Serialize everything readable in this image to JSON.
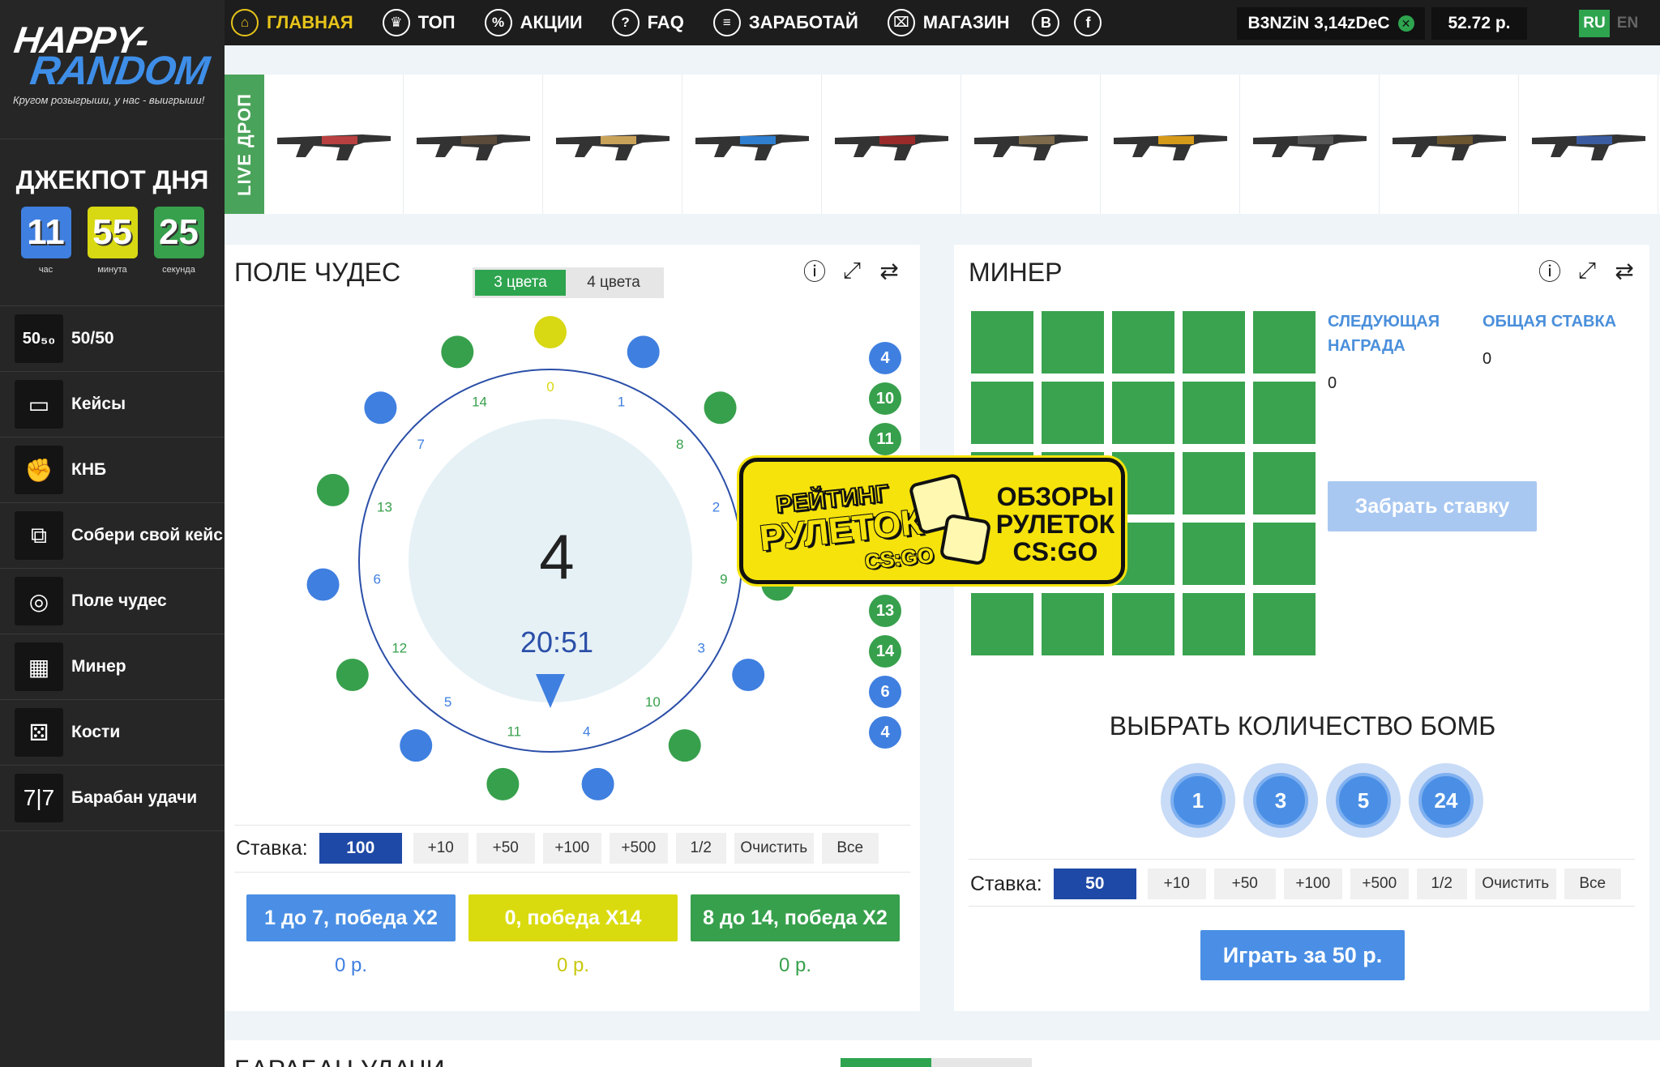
{
  "logo": {
    "line1": "HAPPY-",
    "line2": "RANDOM",
    "tagline": "Кругом розыгрыши, у нас - выигрыши!"
  },
  "jackpot": {
    "title": "ДЖЕКПОТ ДНЯ",
    "timer": [
      {
        "value": "11",
        "label": "час",
        "color": "#3f7fe0"
      },
      {
        "value": "55",
        "label": "минута",
        "color": "#d8d813"
      },
      {
        "value": "25",
        "label": "секунда",
        "color": "#37a04c"
      }
    ]
  },
  "sidebar": {
    "items": [
      {
        "label": "50/50",
        "icon": "5050-icon",
        "glyph": "50₅₀"
      },
      {
        "label": "Кейсы",
        "icon": "case-icon",
        "glyph": "▭"
      },
      {
        "label": "КНБ",
        "icon": "hand-icon",
        "glyph": "✊"
      },
      {
        "label": "Собери свой кейс",
        "icon": "build-case-icon",
        "glyph": "⧉"
      },
      {
        "label": "Поле чудес",
        "icon": "wheel-icon",
        "glyph": "◎"
      },
      {
        "label": "Минер",
        "icon": "grid-icon",
        "glyph": "▦"
      },
      {
        "label": "Кости",
        "icon": "dice-icon",
        "glyph": "⚄"
      },
      {
        "label": "Барабан удачи",
        "icon": "slot-icon",
        "glyph": "7|7"
      }
    ]
  },
  "topnav": {
    "items": [
      {
        "label": "ГЛАВНАЯ",
        "icon": "home-icon",
        "glyph": "⌂",
        "active": true
      },
      {
        "label": "ТОП",
        "icon": "crown-icon",
        "glyph": "♛"
      },
      {
        "label": "АКЦИИ",
        "icon": "percent-icon",
        "glyph": "%"
      },
      {
        "label": "FAQ",
        "icon": "faq-icon",
        "glyph": "?"
      },
      {
        "label": "ЗАРАБОТАЙ",
        "icon": "earn-icon",
        "glyph": "≡"
      },
      {
        "label": "МАГАЗИН",
        "icon": "cart-icon",
        "glyph": "⌧"
      }
    ],
    "social": [
      {
        "label": "B",
        "icon": "vk-icon"
      },
      {
        "label": "f",
        "icon": "facebook-icon"
      }
    ],
    "user": "B3NZiN 3,14zDeC",
    "balance": "52.72 р.",
    "lang_ru": "RU",
    "lang_en": "EN"
  },
  "livedrop": {
    "label": "LIVE ДРОП",
    "items": [
      {
        "name": "m4a1s-icon",
        "color": "#b94040"
      },
      {
        "name": "scar-icon",
        "color": "#5a4a3a"
      },
      {
        "name": "usp-icon",
        "color": "#c9a25a"
      },
      {
        "name": "mp7-icon",
        "color": "#2f7fd0"
      },
      {
        "name": "usp2-icon",
        "color": "#9b2a2a"
      },
      {
        "name": "mp9-icon",
        "color": "#7d6a4c"
      },
      {
        "name": "tec9-icon",
        "color": "#d69a1a"
      },
      {
        "name": "fiveseven-icon",
        "color": "#555"
      },
      {
        "name": "glock-icon",
        "color": "#6a5530"
      },
      {
        "name": "awp-icon",
        "color": "#3a5ba0"
      }
    ]
  },
  "wheel": {
    "title": "ПОЛЕ ЧУДЕС",
    "tab_on": "3 цвета",
    "tab_off": "4 цвета",
    "current": "4",
    "time": "20:51",
    "numbers": [
      "0",
      "1",
      "8",
      "2",
      "9",
      "3",
      "10",
      "4",
      "11",
      "5",
      "12",
      "6",
      "13",
      "7",
      "14"
    ],
    "history": [
      {
        "v": "4",
        "c": "#3f7fe0"
      },
      {
        "v": "10",
        "c": "#37a04c"
      },
      {
        "v": "11",
        "c": "#37a04c"
      },
      {
        "v": "13",
        "c": "#37a04c"
      },
      {
        "v": "14",
        "c": "#37a04c"
      },
      {
        "v": "6",
        "c": "#3f7fe0"
      },
      {
        "v": "4",
        "c": "#3f7fe0"
      }
    ],
    "bet": {
      "label": "Ставка:",
      "value": "100",
      "buttons": [
        "+10",
        "+50",
        "+100",
        "+500",
        "1/2",
        "Очистить",
        "Все"
      ]
    },
    "options": [
      {
        "label": "1 до 7, победа X2",
        "sum": "0 р.",
        "color": "#4a8fe5",
        "text_color": "#3f7fe0"
      },
      {
        "label": "0, победа X14",
        "sum": "0 р.",
        "color": "#dadb0f",
        "text_color": "#c8c80f"
      },
      {
        "label": "8 до 14, победа X2",
        "sum": "0 р.",
        "color": "#37a04c",
        "text_color": "#37a04c"
      }
    ]
  },
  "miner": {
    "title": "МИНЕР",
    "next_reward_label": "СЛЕДУЮЩАЯ НАГРАДА",
    "next_reward": "0",
    "total_bet_label": "ОБЩАЯ СТАВКА",
    "total_bet": "0",
    "take_button": "Забрать ставку",
    "bombs_title": "ВЫБРАТЬ КОЛИЧЕСТВО БОМБ",
    "bombs": [
      "1",
      "3",
      "5",
      "24"
    ],
    "bet": {
      "label": "Ставка:",
      "value": "50",
      "buttons": [
        "+10",
        "+50",
        "+100",
        "+500",
        "1/2",
        "Очистить",
        "Все"
      ]
    },
    "play_button": "Играть за 50 р."
  },
  "ad": {
    "line1": "РЕЙТИНГ",
    "line2": "РУЛЕТОК",
    "line3": "CS:GO",
    "right1": "ОБЗОРЫ",
    "right2": "РУЛЕТОК",
    "right3": "CS:GO"
  },
  "bottom": {
    "title": "БАРАБАН УДАЧИ"
  }
}
